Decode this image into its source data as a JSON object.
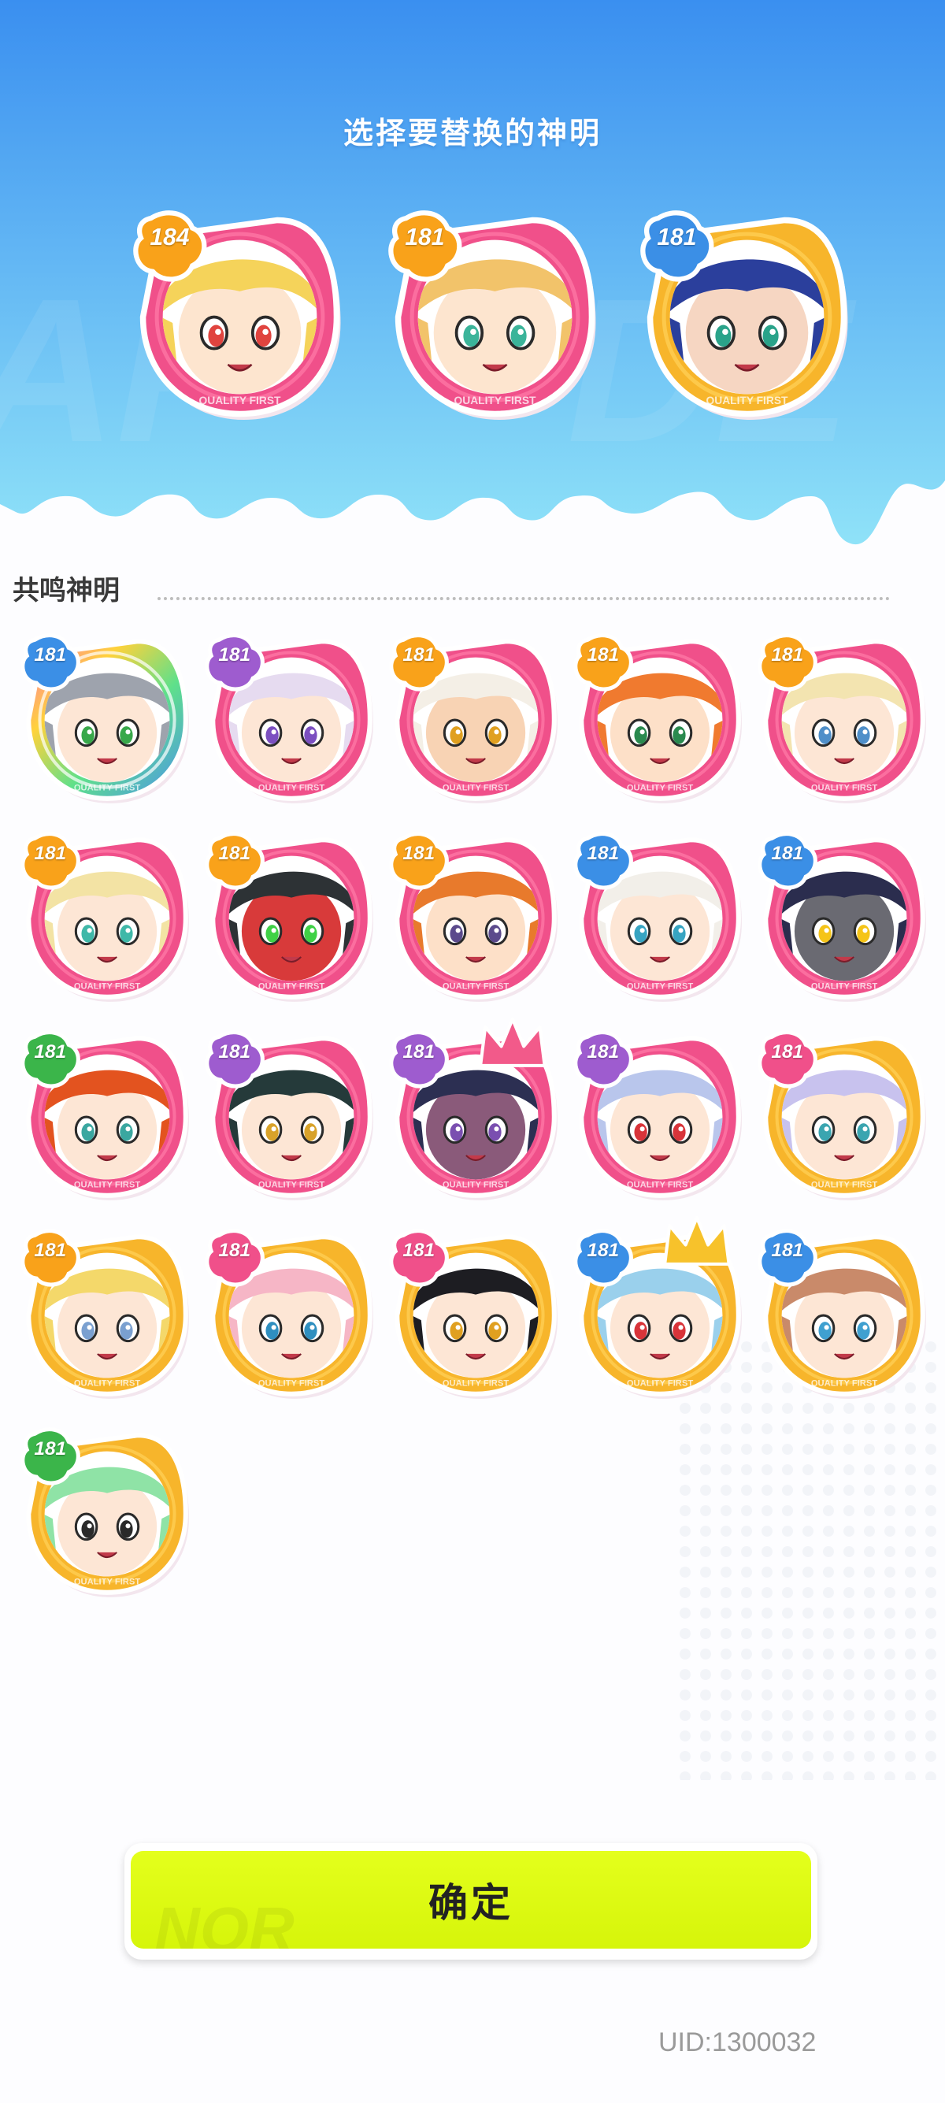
{
  "title": "选择要替换的神明",
  "section_title": "共鸣神明",
  "confirm_label": "确定",
  "uid_text": "UID:1300032",
  "selected": [
    {
      "level": "184",
      "frame": "pink",
      "badge": "orange",
      "hair": "#f5d35a",
      "skin": "#fde5cf",
      "eye": "#e0443f",
      "name": "portrait-blonde-star"
    },
    {
      "level": "181",
      "frame": "pink",
      "badge": "orange",
      "hair": "#f2c36a",
      "skin": "#fde5cf",
      "eye": "#3bb49a",
      "name": "portrait-goggles-girl"
    },
    {
      "level": "181",
      "frame": "gold",
      "badge": "blue",
      "hair": "#2b3f9c",
      "skin": "#f6d6c2",
      "eye": "#2aa38a",
      "name": "portrait-blue-hair"
    }
  ],
  "grid": [
    {
      "level": "181",
      "frame": "rainbow",
      "badge": "blue",
      "hair": "#9ea3ad",
      "skin": "#fde6d5",
      "eye": "#38a84a"
    },
    {
      "level": "181",
      "frame": "pink",
      "badge": "purple",
      "hair": "#e6dbf0",
      "skin": "#fde6d5",
      "eye": "#7b4fc0"
    },
    {
      "level": "181",
      "frame": "pink",
      "badge": "orange",
      "hair": "#f4efe6",
      "skin": "#f8d3b4",
      "eye": "#e0a020"
    },
    {
      "level": "181",
      "frame": "pink",
      "badge": "orange",
      "hair": "#f07a2f",
      "skin": "#fde0c8",
      "eye": "#2a8a4f"
    },
    {
      "level": "181",
      "frame": "pink",
      "badge": "orange",
      "hair": "#f3e4b0",
      "skin": "#fde6d5",
      "eye": "#4f8fc9"
    },
    {
      "level": "181",
      "frame": "pink",
      "badge": "orange",
      "hair": "#f3e3a4",
      "skin": "#fde6d5",
      "eye": "#3fb8a8"
    },
    {
      "level": "181",
      "frame": "pink",
      "badge": "orange",
      "hair": "#2d3235",
      "skin": "#d83a3a",
      "eye": "#3fd146"
    },
    {
      "level": "181",
      "frame": "pink",
      "badge": "orange",
      "hair": "#e87a2c",
      "skin": "#fde0c8",
      "eye": "#5b4a8c"
    },
    {
      "level": "181",
      "frame": "pink",
      "badge": "blue",
      "hair": "#f2efe9",
      "skin": "#fde6d5",
      "eye": "#37a4c2"
    },
    {
      "level": "181",
      "frame": "pink",
      "badge": "blue",
      "hair": "#2b2d4e",
      "skin": "#6a6a72",
      "eye": "#f5c418"
    },
    {
      "level": "181",
      "frame": "pink",
      "badge": "green",
      "hair": "#e3531f",
      "skin": "#fde6d5",
      "eye": "#3aa7a0"
    },
    {
      "level": "181",
      "frame": "pink",
      "badge": "purple",
      "hair": "#253a3a",
      "skin": "#fde6d5",
      "eye": "#d8a22a"
    },
    {
      "level": "181",
      "frame": "pink",
      "badge": "purple",
      "hair": "#2c2f52",
      "skin": "#8a5a7a",
      "eye": "#7a4fb0",
      "crown": "pink"
    },
    {
      "level": "181",
      "frame": "pink",
      "badge": "purple",
      "hair": "#b9c6ec",
      "skin": "#fde6d5",
      "eye": "#d8343a"
    },
    {
      "level": "181",
      "frame": "gold",
      "badge": "pink",
      "hair": "#c8c2ee",
      "skin": "#fde6d5",
      "eye": "#3aa5b0"
    },
    {
      "level": "181",
      "frame": "gold",
      "badge": "orange",
      "hair": "#f4d86a",
      "skin": "#fde6d5",
      "eye": "#7aa0d0"
    },
    {
      "level": "181",
      "frame": "gold",
      "badge": "pink",
      "hair": "#f6b6c6",
      "skin": "#fde6d5",
      "eye": "#2f8fc0"
    },
    {
      "level": "181",
      "frame": "gold",
      "badge": "pink",
      "hair": "#1d1d22",
      "skin": "#fde6d5",
      "eye": "#e0a020"
    },
    {
      "level": "181",
      "frame": "gold",
      "badge": "blue",
      "hair": "#9ad0ec",
      "skin": "#fde6d5",
      "eye": "#d8343a",
      "crown": "gold"
    },
    {
      "level": "181",
      "frame": "gold",
      "badge": "blue",
      "hair": "#c98a6a",
      "skin": "#fde6d5",
      "eye": "#3fa0d0"
    },
    {
      "level": "181",
      "frame": "gold",
      "badge": "green",
      "hair": "#8fe3a6",
      "skin": "#fde6d5",
      "eye": "#2a2a2a"
    }
  ],
  "colors": {
    "pink": "#f0508a",
    "gold": "#f7b52b",
    "orange": "#f9a21a",
    "blue": "#3b8fe6",
    "purple": "#9e5ccf",
    "green": "#3bb54a",
    "header_top": "#3a8ff0",
    "header_bottom": "#8fe0f8"
  }
}
